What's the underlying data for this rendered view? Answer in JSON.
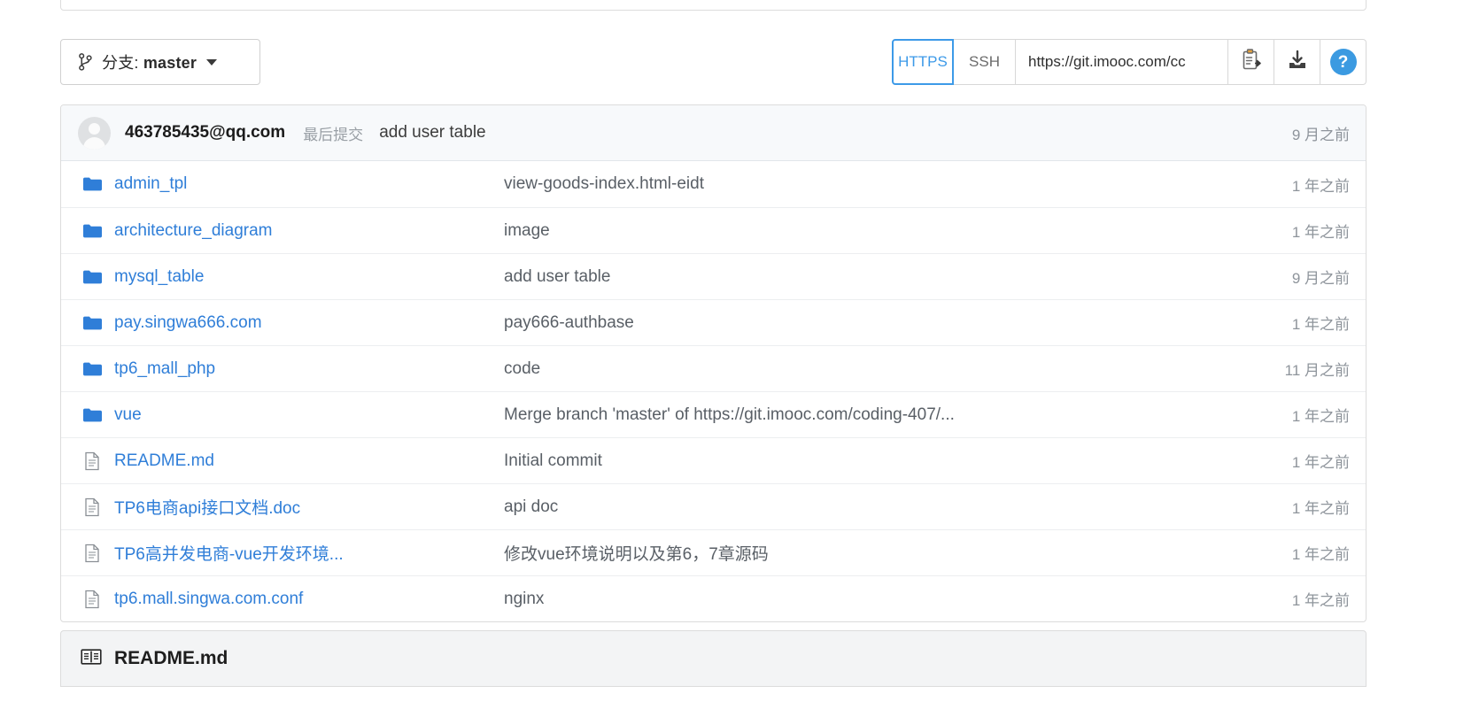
{
  "toolbar": {
    "branch_icon": "branch-icon",
    "branch_prefix": "分支: ",
    "branch_name": "master",
    "protocols": [
      {
        "label": "HTTPS",
        "active": true
      },
      {
        "label": "SSH",
        "active": false
      }
    ],
    "clone_url": "https://git.imooc.com/cc",
    "copy_icon": "clipboard-copy-icon",
    "download_icon": "download-icon",
    "help_icon": "help-circle-icon",
    "help_label": "?"
  },
  "commit_header": {
    "avatar_icon": "user-avatar-icon",
    "author": "463785435@qq.com",
    "label": "最后提交",
    "message": "add user table",
    "time": "9 月之前"
  },
  "files": [
    {
      "icon": "folder-icon",
      "type": "dir",
      "name": "admin_tpl",
      "message": "view-goods-index.html-eidt",
      "time": "1 年之前"
    },
    {
      "icon": "folder-icon",
      "type": "dir",
      "name": "architecture_diagram",
      "message": "image",
      "time": "1 年之前"
    },
    {
      "icon": "folder-icon",
      "type": "dir",
      "name": "mysql_table",
      "message": "add user table",
      "time": "9 月之前"
    },
    {
      "icon": "folder-icon",
      "type": "dir",
      "name": "pay.singwa666.com",
      "message": "pay666-authbase",
      "time": "1 年之前"
    },
    {
      "icon": "folder-icon",
      "type": "dir",
      "name": "tp6_mall_php",
      "message": "code",
      "time": "11 月之前"
    },
    {
      "icon": "folder-icon",
      "type": "dir",
      "name": "vue",
      "message": "Merge branch 'master' of https://git.imooc.com/coding-407/...",
      "time": "1 年之前"
    },
    {
      "icon": "file-icon",
      "type": "file",
      "name": "README.md",
      "message": "Initial commit",
      "time": "1 年之前"
    },
    {
      "icon": "file-icon",
      "type": "file",
      "name": "TP6电商api接口文档.doc",
      "message": "api doc",
      "time": "1 年之前"
    },
    {
      "icon": "file-icon",
      "type": "file",
      "name": "TP6高并发电商-vue开发环境...",
      "message": "修改vue环境说明以及第6，7章源码",
      "time": "1 年之前"
    },
    {
      "icon": "file-icon",
      "type": "file",
      "name": "tp6.mall.singwa.com.conf",
      "message": "nginx",
      "time": "1 年之前"
    }
  ],
  "readme": {
    "icon": "book-icon",
    "title": "README.md"
  },
  "colors": {
    "link": "#2f7ed8",
    "accent": "#3b9ae1",
    "muted": "#8e949b",
    "panel_border": "#dcdcdc"
  }
}
